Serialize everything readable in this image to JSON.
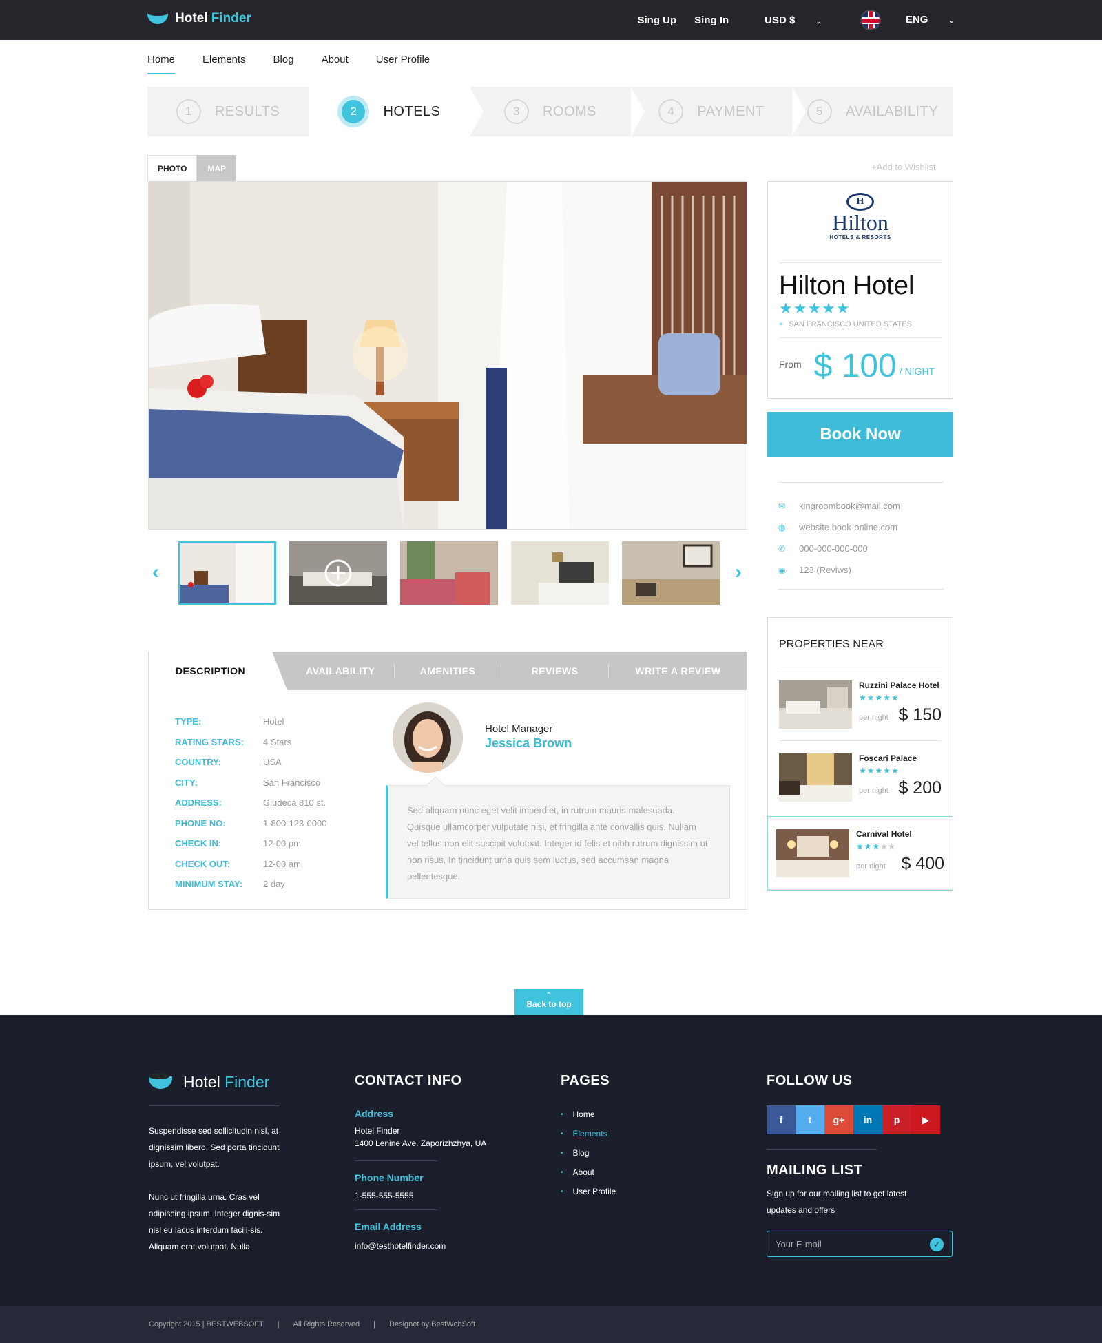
{
  "brand": {
    "name_a": "Hotel",
    "name_b": "Finder"
  },
  "topbar": {
    "signup": "Sing Up",
    "signin": "Sing In",
    "currency": "USD  $",
    "language": "ENG"
  },
  "nav": [
    "Home",
    "Elements",
    "Blog",
    "About",
    "User Profile"
  ],
  "steps": [
    {
      "num": "1",
      "label": "RESULTS"
    },
    {
      "num": "2",
      "label": "HOTELS"
    },
    {
      "num": "3",
      "label": "ROOMS"
    },
    {
      "num": "4",
      "label": "PAYMENT"
    },
    {
      "num": "5",
      "label": "AVAILABILITY"
    }
  ],
  "photo_tabs": {
    "photo": "PHOTO",
    "map": "MAP"
  },
  "wishlist": "+Add to Wishlist",
  "detail_tabs": [
    "DESCRIPTION",
    "AVAILABILITY",
    "AMENITIES",
    "REVIEWS",
    "WRITE A REVIEW"
  ],
  "info": [
    {
      "k": "TYPE:",
      "v": "Hotel"
    },
    {
      "k": "RATING STARS:",
      "v": "4 Stars"
    },
    {
      "k": "COUNTRY:",
      "v": "USA"
    },
    {
      "k": "CITY:",
      "v": "San Francisco"
    },
    {
      "k": "ADDRESS:",
      "v": "Giudeca 810 st."
    },
    {
      "k": "PHONE NO:",
      "v": "1-800-123-0000"
    },
    {
      "k": "CHECK IN:",
      "v": "12-00 pm"
    },
    {
      "k": "CHECK OUT:",
      "v": "12-00 am"
    },
    {
      "k": "MINIMUM STAY:",
      "v": "2 day"
    }
  ],
  "manager": {
    "role": "Hotel Manager",
    "name": "Jessica Brown",
    "quote": "Sed aliquam nunc eget velit imperdiet, in rutrum mauris malesuada. Quisque ullamcorper vulputate nisi, et fringilla ante convallis quis. Nullam vel tellus non elit suscipit volutpat. Integer id felis et nibh rutrum dignissim ut non risus. In tincidunt urna quis sem luctus, sed accumsan magna pellentesque."
  },
  "hotel": {
    "logo": "Hilton",
    "logo_sub": "HOTELS & RESORTS",
    "name": "Hilton Hotel",
    "stars": "★★★★★",
    "location": "SAN FRANCISCO UNITED STATES",
    "from": "From",
    "price": "$ 100",
    "per": "/ NIGHT"
  },
  "book": "Book Now",
  "contacts": [
    "kingroombook@mail.com",
    "website.book-online.com",
    "000-000-000-000",
    "123 (Reviws)"
  ],
  "properties": {
    "title": "PROPERTIES NEAR",
    "items": [
      {
        "name": "Ruzzini Palace Hotel",
        "stars": "★★★★★",
        "per": "per night",
        "price": "$ 150"
      },
      {
        "name": "Foscari Palace",
        "stars": "★★★★★",
        "per": "per night",
        "price": "$ 200"
      },
      {
        "name": "Carnival Hotel",
        "stars": "★★★",
        "stars_off": "★★",
        "per": "per night",
        "price": "$ 400"
      }
    ]
  },
  "back_to_top": "Back to top",
  "footer": {
    "about1": "Suspendisse sed sollicitudin nisl, at dignissim libero. Sed porta tincidunt ipsum, vel volutpat.",
    "about2": "Nunc ut fringilla urna. Cras vel adipiscing ipsum. Integer dignis-sim nisl eu lacus interdum facili-sis. Aliquam erat volutpat. Nulla",
    "contact_title": "CONTACT INFO",
    "address_label": "Address",
    "address1": "Hotel Finder",
    "address2": "1400 Lenine Ave. Zaporizhzhya, UA",
    "phone_label": "Phone Number",
    "phone": "1-555-555-5555",
    "email_label": "Email Address",
    "email": "info@testhotelfinder.com",
    "pages_title": "PAGES",
    "pages": [
      "Home",
      "Elements",
      "Blog",
      "About",
      "User Profile"
    ],
    "follow_title": "FOLLOW US",
    "social": [
      "f",
      "t",
      "g+",
      "in",
      "p",
      "▶"
    ],
    "mailing_title": "MAILING LIST",
    "mailing_text": "Sign up for our mailing list to get latest updates and offers",
    "email_placeholder": "Your E-mail"
  },
  "copyright": {
    "a": "Copyright  2015  |  BESTWEBSOFT",
    "b": "All Rights Reserved",
    "c": "Designet by BestWebSoft"
  },
  "colors": {
    "accent": "#40c4de",
    "topbar": "#24262b",
    "footer": "#1b1f2b",
    "facebook": "#3b5998",
    "twitter": "#55acee",
    "google": "#dd4b39",
    "linkedin": "#0077b5",
    "pinterest": "#cb2027",
    "youtube": "#cc181e"
  }
}
